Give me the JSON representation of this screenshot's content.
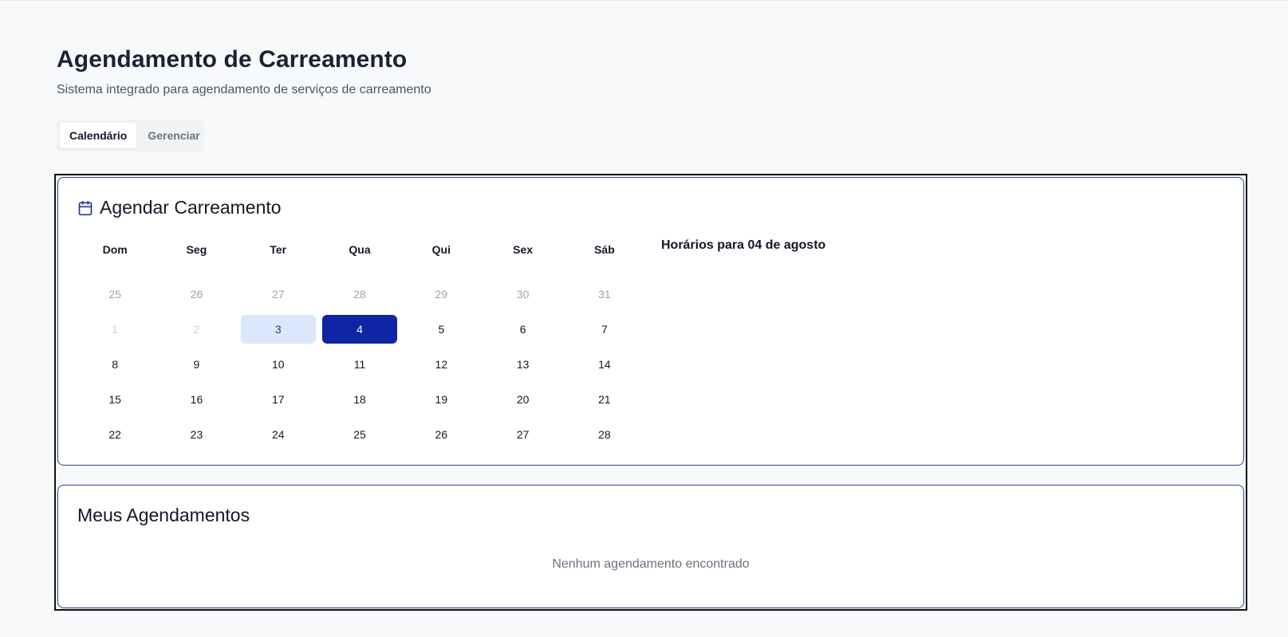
{
  "header": {
    "title": "Agendamento de Carreamento",
    "subtitle": "Sistema integrado para agendamento de serviços de carreamento"
  },
  "tabs": [
    {
      "label": "Calendário",
      "active": true
    },
    {
      "label": "Gerenciar",
      "active": false
    }
  ],
  "schedule_card": {
    "title": "Agendar Carreamento",
    "icon": "calendar-icon",
    "weekdays": [
      "Dom",
      "Seg",
      "Ter",
      "Qua",
      "Qui",
      "Sex",
      "Sáb"
    ],
    "weeks": [
      [
        {
          "label": "25",
          "state": "outside"
        },
        {
          "label": "26",
          "state": "outside"
        },
        {
          "label": "27",
          "state": "outside"
        },
        {
          "label": "28",
          "state": "outside"
        },
        {
          "label": "29",
          "state": "outside"
        },
        {
          "label": "30",
          "state": "outside"
        },
        {
          "label": "31",
          "state": "outside"
        }
      ],
      [
        {
          "label": "1",
          "state": "disabled"
        },
        {
          "label": "2",
          "state": "disabled"
        },
        {
          "label": "3",
          "state": "today"
        },
        {
          "label": "4",
          "state": "selected"
        },
        {
          "label": "5",
          "state": "normal"
        },
        {
          "label": "6",
          "state": "normal"
        },
        {
          "label": "7",
          "state": "normal"
        }
      ],
      [
        {
          "label": "8",
          "state": "normal"
        },
        {
          "label": "9",
          "state": "normal"
        },
        {
          "label": "10",
          "state": "normal"
        },
        {
          "label": "11",
          "state": "normal"
        },
        {
          "label": "12",
          "state": "normal"
        },
        {
          "label": "13",
          "state": "normal"
        },
        {
          "label": "14",
          "state": "normal"
        }
      ],
      [
        {
          "label": "15",
          "state": "normal"
        },
        {
          "label": "16",
          "state": "normal"
        },
        {
          "label": "17",
          "state": "normal"
        },
        {
          "label": "18",
          "state": "normal"
        },
        {
          "label": "19",
          "state": "normal"
        },
        {
          "label": "20",
          "state": "normal"
        },
        {
          "label": "21",
          "state": "normal"
        }
      ],
      [
        {
          "label": "22",
          "state": "normal"
        },
        {
          "label": "23",
          "state": "normal"
        },
        {
          "label": "24",
          "state": "normal"
        },
        {
          "label": "25",
          "state": "normal"
        },
        {
          "label": "26",
          "state": "normal"
        },
        {
          "label": "27",
          "state": "normal"
        },
        {
          "label": "28",
          "state": "normal"
        }
      ]
    ],
    "slots_title": "Horários para 04 de agosto"
  },
  "my_bookings": {
    "title": "Meus Agendamentos",
    "empty_message": "Nenhum agendamento encontrado"
  },
  "colors": {
    "accent": "#0e25a5",
    "today_bg": "#dbe7fb",
    "card_border": "#2b3f97",
    "background": "#f8f9fb"
  }
}
